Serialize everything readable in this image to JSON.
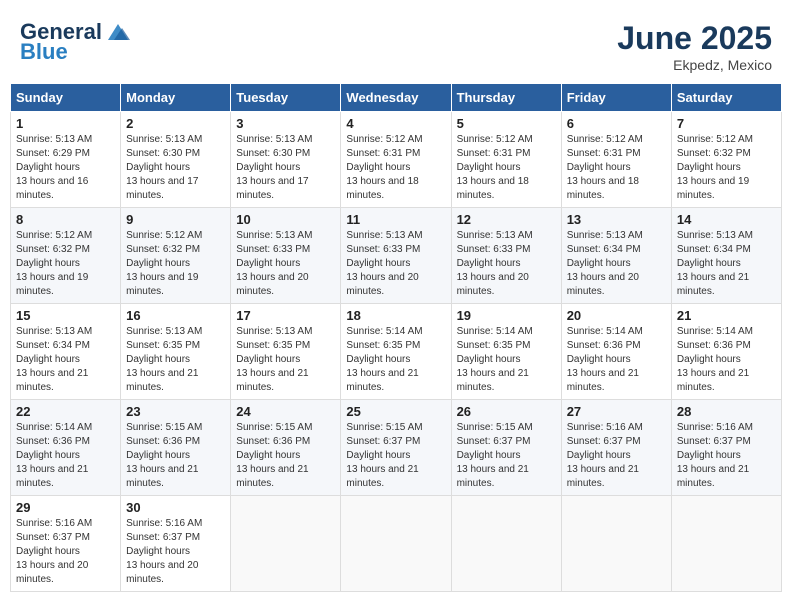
{
  "header": {
    "logo_line1": "General",
    "logo_line2": "Blue",
    "month_year": "June 2025",
    "location": "Ekpedz, Mexico"
  },
  "weekdays": [
    "Sunday",
    "Monday",
    "Tuesday",
    "Wednesday",
    "Thursday",
    "Friday",
    "Saturday"
  ],
  "weeks": [
    [
      {
        "day": "1",
        "sunrise": "5:13 AM",
        "sunset": "6:29 PM",
        "daylight": "13 hours and 16 minutes."
      },
      {
        "day": "2",
        "sunrise": "5:13 AM",
        "sunset": "6:30 PM",
        "daylight": "13 hours and 17 minutes."
      },
      {
        "day": "3",
        "sunrise": "5:13 AM",
        "sunset": "6:30 PM",
        "daylight": "13 hours and 17 minutes."
      },
      {
        "day": "4",
        "sunrise": "5:12 AM",
        "sunset": "6:31 PM",
        "daylight": "13 hours and 18 minutes."
      },
      {
        "day": "5",
        "sunrise": "5:12 AM",
        "sunset": "6:31 PM",
        "daylight": "13 hours and 18 minutes."
      },
      {
        "day": "6",
        "sunrise": "5:12 AM",
        "sunset": "6:31 PM",
        "daylight": "13 hours and 18 minutes."
      },
      {
        "day": "7",
        "sunrise": "5:12 AM",
        "sunset": "6:32 PM",
        "daylight": "13 hours and 19 minutes."
      }
    ],
    [
      {
        "day": "8",
        "sunrise": "5:12 AM",
        "sunset": "6:32 PM",
        "daylight": "13 hours and 19 minutes."
      },
      {
        "day": "9",
        "sunrise": "5:12 AM",
        "sunset": "6:32 PM",
        "daylight": "13 hours and 19 minutes."
      },
      {
        "day": "10",
        "sunrise": "5:13 AM",
        "sunset": "6:33 PM",
        "daylight": "13 hours and 20 minutes."
      },
      {
        "day": "11",
        "sunrise": "5:13 AM",
        "sunset": "6:33 PM",
        "daylight": "13 hours and 20 minutes."
      },
      {
        "day": "12",
        "sunrise": "5:13 AM",
        "sunset": "6:33 PM",
        "daylight": "13 hours and 20 minutes."
      },
      {
        "day": "13",
        "sunrise": "5:13 AM",
        "sunset": "6:34 PM",
        "daylight": "13 hours and 20 minutes."
      },
      {
        "day": "14",
        "sunrise": "5:13 AM",
        "sunset": "6:34 PM",
        "daylight": "13 hours and 21 minutes."
      }
    ],
    [
      {
        "day": "15",
        "sunrise": "5:13 AM",
        "sunset": "6:34 PM",
        "daylight": "13 hours and 21 minutes."
      },
      {
        "day": "16",
        "sunrise": "5:13 AM",
        "sunset": "6:35 PM",
        "daylight": "13 hours and 21 minutes."
      },
      {
        "day": "17",
        "sunrise": "5:13 AM",
        "sunset": "6:35 PM",
        "daylight": "13 hours and 21 minutes."
      },
      {
        "day": "18",
        "sunrise": "5:14 AM",
        "sunset": "6:35 PM",
        "daylight": "13 hours and 21 minutes."
      },
      {
        "day": "19",
        "sunrise": "5:14 AM",
        "sunset": "6:35 PM",
        "daylight": "13 hours and 21 minutes."
      },
      {
        "day": "20",
        "sunrise": "5:14 AM",
        "sunset": "6:36 PM",
        "daylight": "13 hours and 21 minutes."
      },
      {
        "day": "21",
        "sunrise": "5:14 AM",
        "sunset": "6:36 PM",
        "daylight": "13 hours and 21 minutes."
      }
    ],
    [
      {
        "day": "22",
        "sunrise": "5:14 AM",
        "sunset": "6:36 PM",
        "daylight": "13 hours and 21 minutes."
      },
      {
        "day": "23",
        "sunrise": "5:15 AM",
        "sunset": "6:36 PM",
        "daylight": "13 hours and 21 minutes."
      },
      {
        "day": "24",
        "sunrise": "5:15 AM",
        "sunset": "6:36 PM",
        "daylight": "13 hours and 21 minutes."
      },
      {
        "day": "25",
        "sunrise": "5:15 AM",
        "sunset": "6:37 PM",
        "daylight": "13 hours and 21 minutes."
      },
      {
        "day": "26",
        "sunrise": "5:15 AM",
        "sunset": "6:37 PM",
        "daylight": "13 hours and 21 minutes."
      },
      {
        "day": "27",
        "sunrise": "5:16 AM",
        "sunset": "6:37 PM",
        "daylight": "13 hours and 21 minutes."
      },
      {
        "day": "28",
        "sunrise": "5:16 AM",
        "sunset": "6:37 PM",
        "daylight": "13 hours and 21 minutes."
      }
    ],
    [
      {
        "day": "29",
        "sunrise": "5:16 AM",
        "sunset": "6:37 PM",
        "daylight": "13 hours and 20 minutes."
      },
      {
        "day": "30",
        "sunrise": "5:16 AM",
        "sunset": "6:37 PM",
        "daylight": "13 hours and 20 minutes."
      },
      null,
      null,
      null,
      null,
      null
    ]
  ],
  "labels": {
    "sunrise": "Sunrise:",
    "sunset": "Sunset:",
    "daylight": "Daylight hours"
  }
}
